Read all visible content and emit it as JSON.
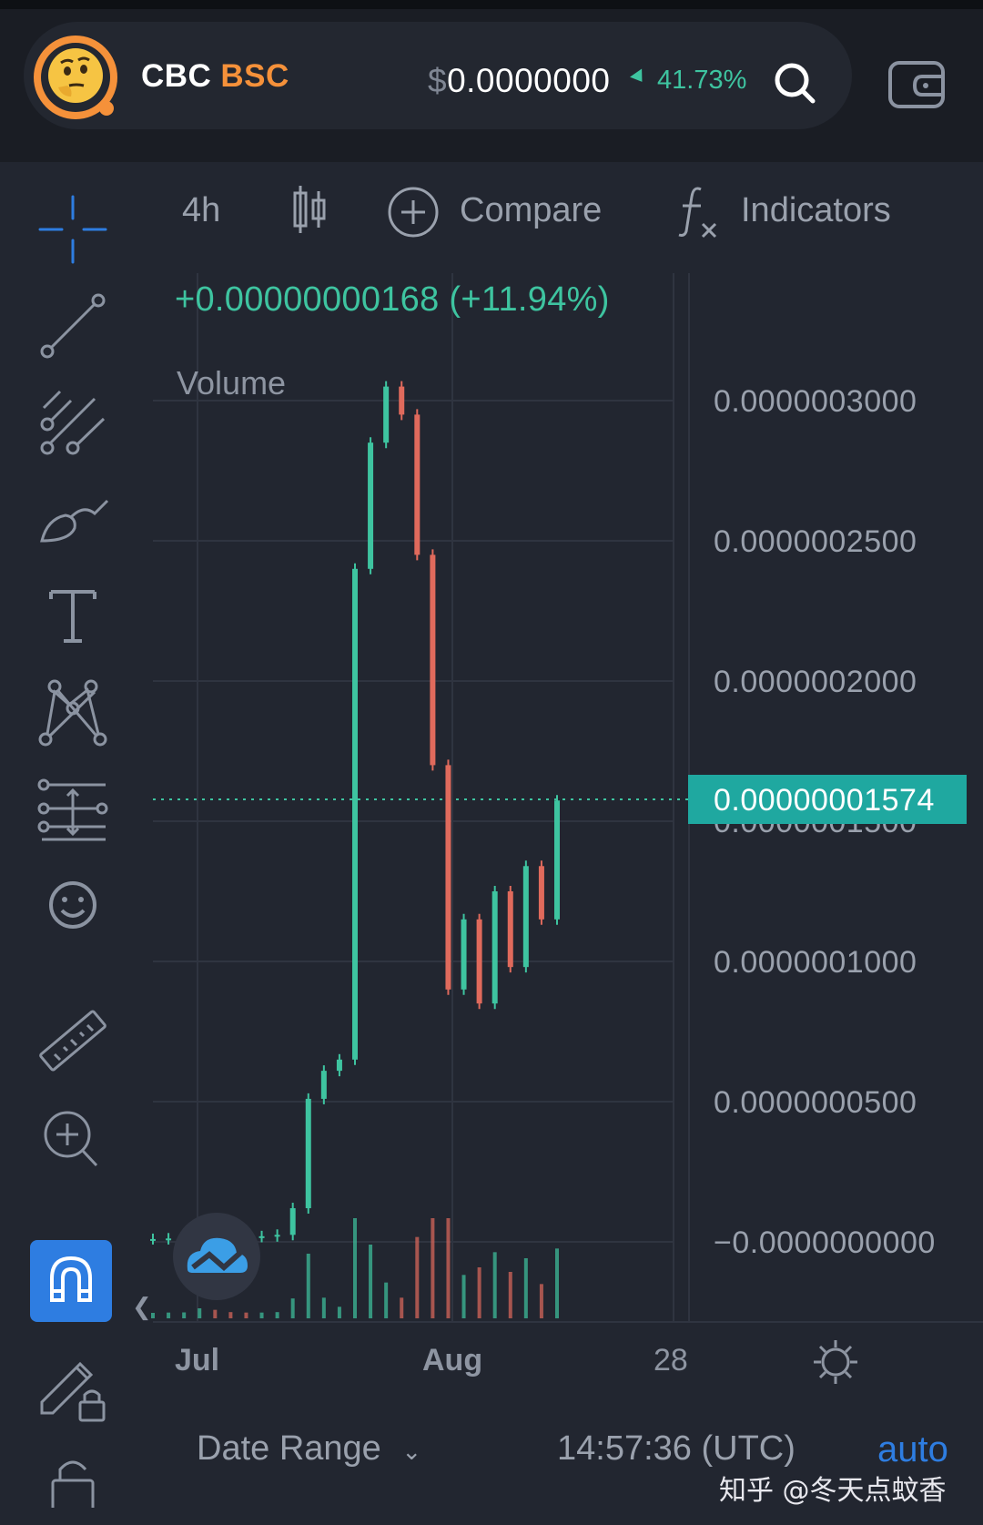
{
  "header": {
    "symbol": "CBC",
    "network": "BSC",
    "price_currency": "$",
    "price": "0.0000000",
    "change_percent": "41.73%"
  },
  "toolbar": {
    "interval": "4h",
    "compare_label": "Compare",
    "indicators_label": "Indicators"
  },
  "chart": {
    "change_text": "+0.00000000168 (+11.94%)",
    "volume_label": "Volume",
    "y_ticks": [
      "0.0000003000",
      "0.0000002500",
      "0.0000002000",
      "0.0000001500",
      "0.0000001000",
      "0.0000000500",
      "−0.0000000000"
    ],
    "current_price_tag": "0.00000001574",
    "x_ticks": [
      "Jul",
      "Aug",
      "28"
    ]
  },
  "footer": {
    "date_range_label": "Date Range",
    "time": "14:57:36 (UTC)",
    "auto_label": "auto"
  },
  "watermark": "知乎 @冬天点蚊香",
  "colors": {
    "up": "#3ec4a0",
    "down": "#e06a5c",
    "accent": "#2e7de1",
    "network": "#f5913a"
  },
  "chart_data": {
    "type": "line",
    "title": "",
    "xlabel": "",
    "ylabel": "",
    "x_ticks": [
      "Jul",
      "Aug",
      "28"
    ],
    "ylim": [
      0,
      3.2e-07
    ],
    "series": [
      {
        "values": [
          1e-09,
          1.2e-09,
          1.5e-09,
          4.5e-09,
          2.5e-09,
          2e-09,
          1.8e-09,
          2e-09,
          2.5e-09,
          1.2e-08,
          5.1e-08,
          6.1e-08,
          6.5e-08,
          2.4e-07,
          2.85e-07,
          3.05e-07,
          2.95e-07,
          2.45e-07,
          1.7e-07,
          9e-08,
          1.15e-07,
          8.5e-08,
          1.25e-07,
          9.8e-08,
          1.34e-07,
          1.15e-07,
          1.574e-07
        ]
      }
    ]
  }
}
